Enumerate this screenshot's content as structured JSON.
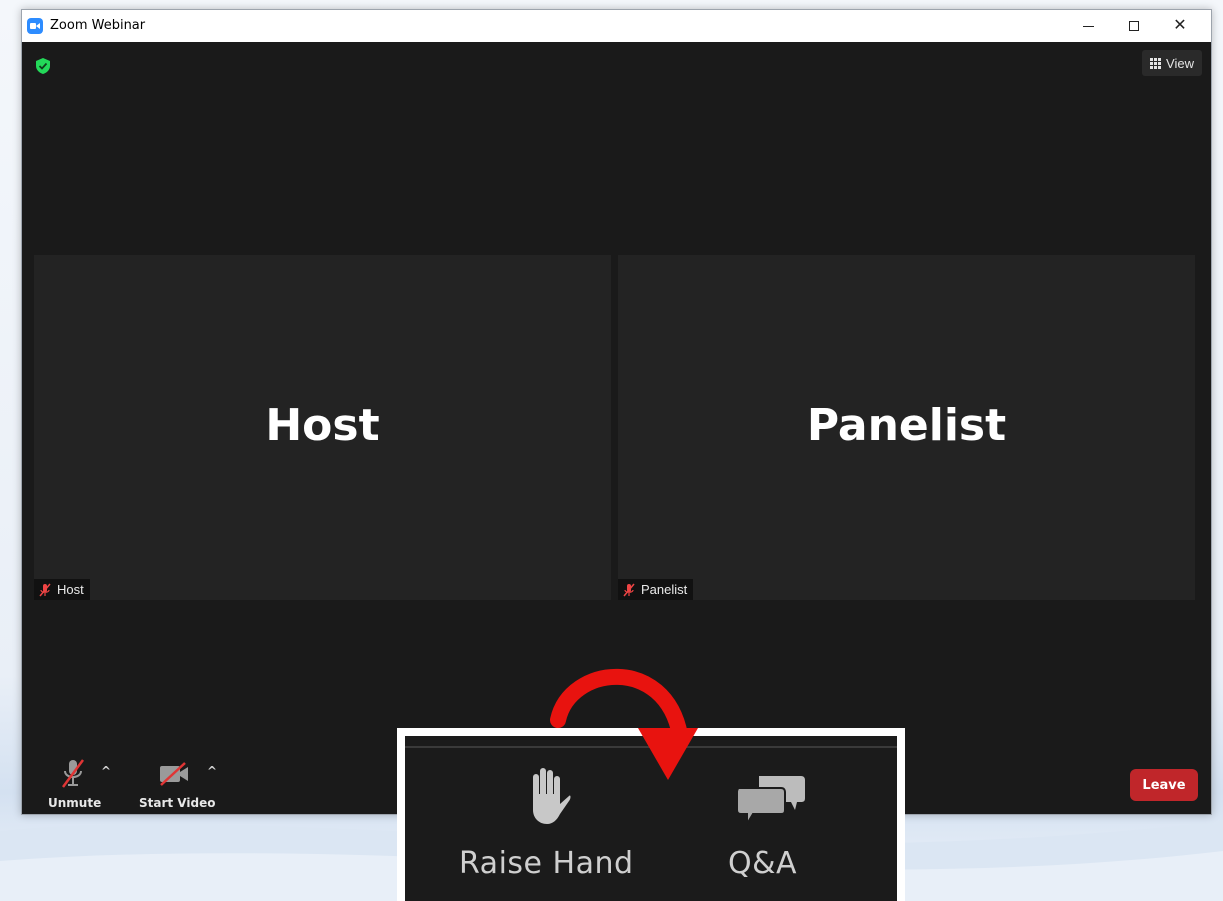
{
  "window": {
    "title": "Zoom Webinar"
  },
  "top_bar": {
    "view_label": "View"
  },
  "tiles": [
    {
      "name": "Host",
      "label": "Host"
    },
    {
      "name": "Panelist",
      "label": "Panelist"
    }
  ],
  "toolbar": {
    "unmute_label": "Unmute",
    "start_video_label": "Start Video",
    "leave_label": "Leave"
  },
  "callout": {
    "raise_hand_label": "Raise Hand",
    "qa_label": "Q&A"
  },
  "colors": {
    "accent": "#2d8cff",
    "leave": "#c0262a",
    "shield": "#23d959",
    "arrow": "#e8130f"
  }
}
